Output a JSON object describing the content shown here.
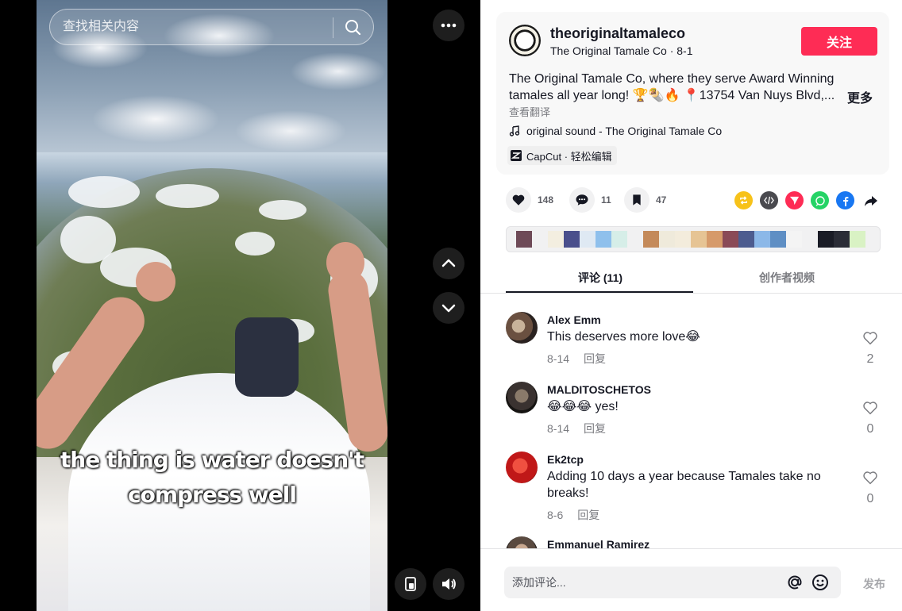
{
  "search": {
    "placeholder": "查找相关内容"
  },
  "video": {
    "caption_line1": "the thing is water doesn't",
    "caption_line2": "compress well"
  },
  "author": {
    "username": "theoriginaltamaleco",
    "display_name": "The Original Tamale Co",
    "date": "8-1",
    "follow_label": "关注"
  },
  "description": {
    "text": "The Original Tamale Co, where they serve Award Winning tamales all year long! 🏆🌯🔥 📍13754 Van Nuys Blvd,...",
    "more_label": "更多",
    "translate_label": "查看翻译"
  },
  "music": {
    "label": "original sound - The Original Tamale Co"
  },
  "capcut": {
    "label": "CapCut · 轻松编辑"
  },
  "actions": {
    "likes": "148",
    "comments": "11",
    "saves": "47"
  },
  "share_colors": {
    "repost": "#f7c21a",
    "embed": "#4a4a4f",
    "send": "#fe2c55",
    "whatsapp": "#25d366",
    "facebook": "#1877f2"
  },
  "palette": [
    "#6e4a57",
    "#f3eee0",
    "#4a4f8c",
    "#dfe9f3",
    "#8fc0ec",
    "#d6eee8",
    "#c48a5a",
    "#efeadb",
    "#f3ecdc",
    "#e6c494",
    "#d69a6a",
    "#8a4a57",
    "#4d5c8f",
    "#8cb8e8",
    "#5f8fc4",
    "#f4f4f4",
    "#1a1c26",
    "#2a2c36",
    "#d9f2c4"
  ],
  "tabs": {
    "comments": "评论 (11)",
    "creator_videos": "创作者视频"
  },
  "comments": [
    {
      "name": "Alex Emm",
      "text": "This deserves more love😂",
      "date": "8-14",
      "reply": "回复",
      "likes": "2"
    },
    {
      "name": "MALDITOSCHETOS",
      "text": "😂😂😂 yes!",
      "date": "8-14",
      "reply": "回复",
      "likes": "0"
    },
    {
      "name": "Ek2tcp",
      "text": "Adding 10 days a year because Tamales take no breaks!",
      "date": "8-6",
      "reply": "回复",
      "likes": "0"
    },
    {
      "name": "Emmanuel Ramirez"
    }
  ],
  "composer": {
    "placeholder": "添加评论...",
    "post_label": "发布"
  }
}
